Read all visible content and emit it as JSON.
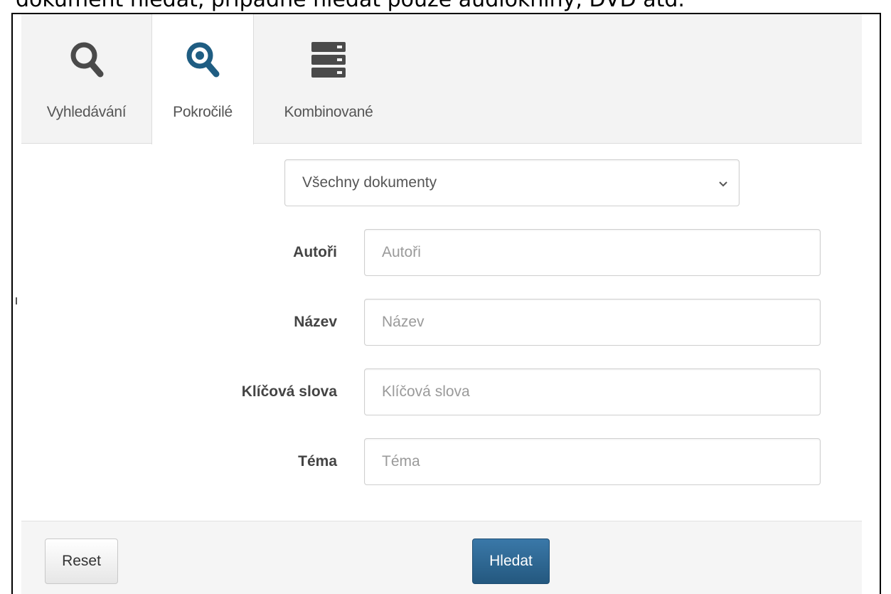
{
  "caption": "dokument hledat, případně hledat pouze audioknihy, DVD atd.",
  "tabs": [
    {
      "label": "Vyhledávání",
      "icon": "search-icon",
      "active": false
    },
    {
      "label": "Pokročilé",
      "icon": "advanced-search-icon",
      "active": true
    },
    {
      "label": "Kombinované",
      "icon": "stack-icon",
      "active": false
    }
  ],
  "document_type": {
    "selected": "Všechny dokumenty"
  },
  "fields": {
    "authors": {
      "label": "Autoři",
      "placeholder": "Autoři"
    },
    "title": {
      "label": "Název",
      "placeholder": "Název"
    },
    "keywords": {
      "label": "Klíčová slova",
      "placeholder": "Klíčová slova"
    },
    "topic": {
      "label": "Téma",
      "placeholder": "Téma"
    }
  },
  "buttons": {
    "reset": "Reset",
    "search": "Hledat"
  },
  "colors": {
    "icon_gray": "#4a4a4a",
    "icon_blue": "#1f5d82",
    "primary": "#2a6592"
  }
}
